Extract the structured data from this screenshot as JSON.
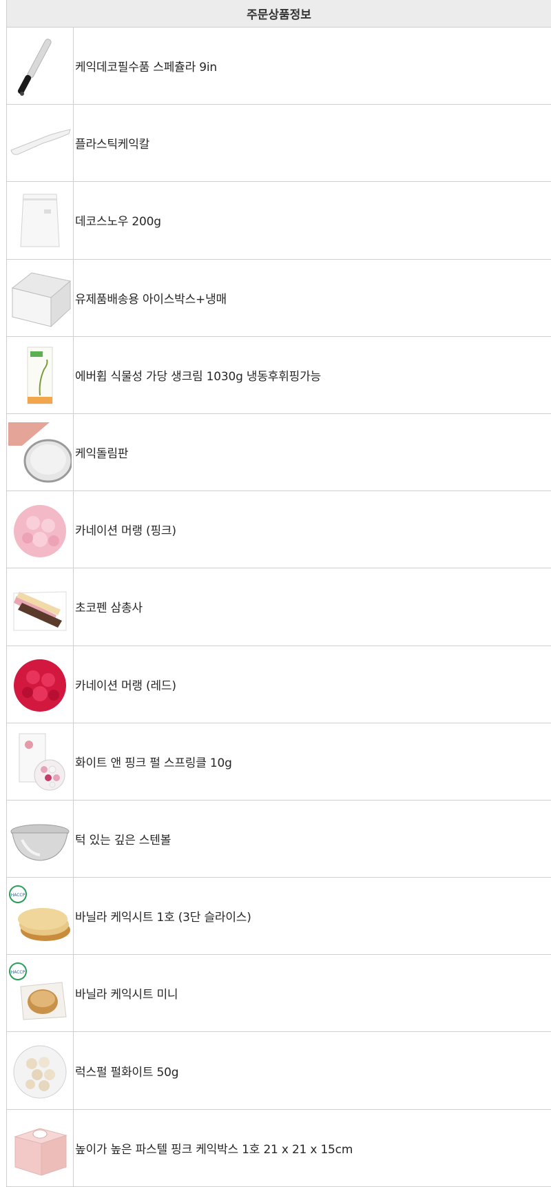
{
  "header": {
    "title": "주문상품정보"
  },
  "items": [
    {
      "name": "케익데코필수품 스페츌라 9in",
      "image": "spatula-image"
    },
    {
      "name": "플라스틱케익칼",
      "image": "plastic-cake-knife-image"
    },
    {
      "name": "데코스노우 200g",
      "image": "deco-snow-pouch-image"
    },
    {
      "name": "유제품배송용 아이스박스+냉매",
      "image": "ice-box-image"
    },
    {
      "name": "에버휩 식물성 가당 생크림 1030g 냉동후휘핑가능",
      "image": "whipping-cream-pack-image"
    },
    {
      "name": "케익돌림판",
      "image": "cake-turntable-image"
    },
    {
      "name": "카네이션 머랭 (핑크)",
      "image": "pink-carnation-meringue-image"
    },
    {
      "name": "초코펜 삼총사",
      "image": "choco-pen-set-image"
    },
    {
      "name": "카네이션 머랭 (레드)",
      "image": "red-carnation-meringue-image"
    },
    {
      "name": "화이트 앤 핑크 펄 스프링클 10g",
      "image": "pearl-sprinkle-image"
    },
    {
      "name": "턱 있는 깊은 스텐볼",
      "image": "steel-bowl-image"
    },
    {
      "name": "바닐라 케익시트 1호 (3단 슬라이스)",
      "image": "vanilla-cake-sheet-image",
      "badge": "HACCP"
    },
    {
      "name": "바닐라 케익시트 미니",
      "image": "vanilla-cake-mini-image",
      "badge": "HACCP"
    },
    {
      "name": "럭스펄 펄화이트 50g",
      "image": "lux-pearl-white-image"
    },
    {
      "name": "높이가 높은 파스텔 핑크 케익박스 1호 21 x 21 x 15cm",
      "image": "pink-cake-box-image"
    }
  ]
}
